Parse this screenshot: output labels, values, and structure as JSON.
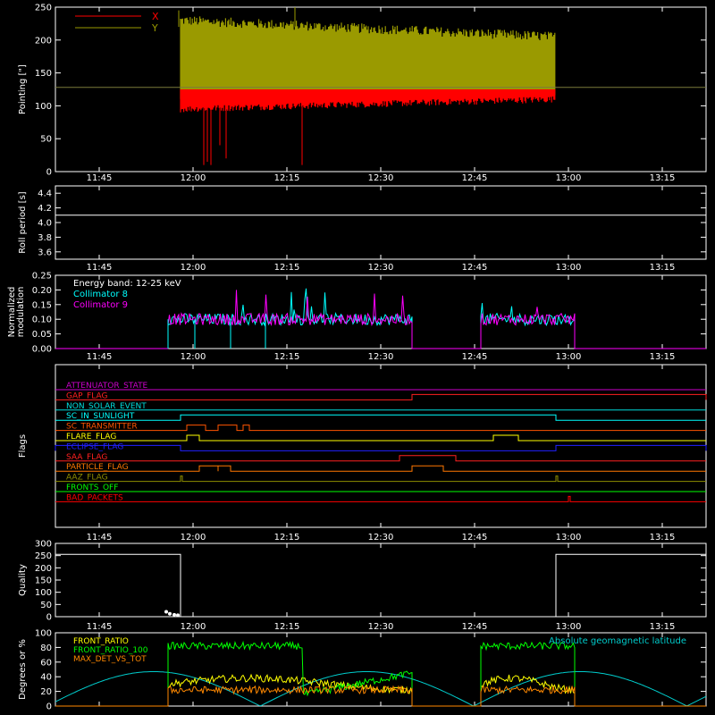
{
  "time_ticks": [
    "11:45",
    "12:00",
    "12:15",
    "12:30",
    "12:45",
    "13:00",
    "13:15"
  ],
  "chart_data": [
    {
      "type": "line",
      "ylabel": "Pointing [\"]",
      "ylim": [
        0,
        250
      ],
      "yticks": [
        "0",
        "50",
        "100",
        "150",
        "200",
        "250"
      ],
      "legend": [
        {
          "name": "X",
          "color": "#ff0000"
        },
        {
          "name": "Y",
          "color": "#9a9a00"
        }
      ],
      "x_range": [
        "11:38",
        "13:22"
      ],
      "series": [
        {
          "name": "X",
          "color": "#ff0000",
          "start": "11:58",
          "end": "12:58",
          "band_low": [
            95,
            112
          ],
          "band_high": [
            200,
            215
          ],
          "dips_to": [
            10,
            15,
            10,
            20,
            50
          ]
        },
        {
          "name": "Y",
          "color": "#9a9a00",
          "start": "11:58",
          "end": "12:58",
          "band_low": [
            100,
            115
          ],
          "band_high": [
            235,
            210
          ],
          "spikes_to": [
            245,
            250
          ]
        }
      ],
      "reference_line": 128
    },
    {
      "type": "line",
      "ylabel": "Roll period [s]",
      "ylim": [
        3.5,
        4.5
      ],
      "yticks": [
        "3.6",
        "3.8",
        "4.0",
        "4.2",
        "4.4"
      ],
      "series": [
        {
          "name": "",
          "color": "#ffffff",
          "value": 4.1
        }
      ]
    },
    {
      "type": "line",
      "ylabel": "Normalized modulation",
      "ylim": [
        0,
        0.25
      ],
      "yticks": [
        "0.00",
        "0.05",
        "0.10",
        "0.15",
        "0.20",
        "0.25"
      ],
      "annotation": "Energy band: 12-25 keV",
      "series": [
        {
          "name": "Collimator 8",
          "color": "#00ffff",
          "segments": [
            [
              "11:56",
              "12:35"
            ],
            [
              "12:46",
              "13:01"
            ]
          ],
          "level": 0.1
        },
        {
          "name": "Collimator 9",
          "color": "#ff00ff",
          "segments": [
            [
              "11:56",
              "12:35"
            ],
            [
              "12:46",
              "13:01"
            ]
          ],
          "level": 0.1
        }
      ]
    },
    {
      "type": "line",
      "ylabel": "Flags",
      "flags": [
        {
          "name": "ATTENUATOR_STATE",
          "color": "#cc00cc",
          "high": []
        },
        {
          "name": "GAP_FLAG",
          "color": "#ff2020",
          "high": [
            [
              "12:35",
              "13:22"
            ]
          ]
        },
        {
          "name": "NON_SOLAR_EVENT",
          "color": "#00dddd",
          "high": []
        },
        {
          "name": "SC_IN_SUNLIGHT",
          "color": "#00ffff",
          "high": [
            [
              "11:58",
              "12:58"
            ]
          ]
        },
        {
          "name": "SC_TRANSMITTER",
          "color": "#ff5500",
          "high": [
            [
              "11:59",
              "12:02"
            ],
            [
              "12:04",
              "12:07"
            ],
            [
              "12:08",
              "12:09"
            ]
          ]
        },
        {
          "name": "FLARE_FLAG",
          "color": "#ffff00",
          "high": [
            [
              "11:59",
              "12:01"
            ],
            [
              "12:48",
              "12:52"
            ]
          ]
        },
        {
          "name": "ECLIPSE_FLAG",
          "color": "#2020ff",
          "high": [
            [
              "11:38",
              "11:58"
            ],
            [
              "12:58",
              "13:22"
            ]
          ]
        },
        {
          "name": "SAA_FLAG",
          "color": "#ff2020",
          "high": [
            [
              "12:33",
              "12:42"
            ]
          ]
        },
        {
          "name": "PARTICLE_FLAG",
          "color": "#ff7700",
          "high": [
            [
              "12:01",
              "12:04"
            ],
            [
              "12:04",
              "12:06"
            ],
            [
              "12:35",
              "12:40"
            ]
          ]
        },
        {
          "name": "AAZ_FLAG",
          "color": "#8f8f00",
          "high": [
            [
              "11:58",
              "11:58"
            ],
            [
              "12:58",
              "12:58"
            ]
          ]
        },
        {
          "name": "FRONTS_OFF",
          "color": "#00ff00",
          "high": []
        },
        {
          "name": "BAD_PACKETS",
          "color": "#ff0000",
          "high": [
            [
              "13:00",
              "13:00"
            ]
          ]
        }
      ]
    },
    {
      "type": "line",
      "ylabel": "Quality",
      "ylim": [
        0,
        300
      ],
      "yticks": [
        "0",
        "50",
        "100",
        "150",
        "200",
        "250",
        "300"
      ],
      "series": [
        {
          "name": "",
          "color": "#ffffff",
          "high_value": 255,
          "high_segments": [
            [
              "11:38",
              "11:58"
            ],
            [
              "12:58",
              "13:22"
            ]
          ]
        }
      ]
    },
    {
      "type": "line",
      "ylabel": "Degrees or %",
      "ylim": [
        0,
        100
      ],
      "yticks": [
        "0",
        "20",
        "40",
        "60",
        "80",
        "100"
      ],
      "annotation": "Absolute geomagnetic latitude",
      "series": [
        {
          "name": "FRONT_RATIO",
          "color": "#ffff00",
          "level": 30
        },
        {
          "name": "FRONT_RATIO_100",
          "color": "#00ff00",
          "level": 82
        },
        {
          "name": "MAX_DET_VS_TOT",
          "color": "#ff8800",
          "level": 22
        },
        {
          "name": "Absolute geomagnetic latitude",
          "color": "#00cccc",
          "peak": 47
        }
      ],
      "segments": [
        [
          "11:56",
          "12:35"
        ],
        [
          "12:46",
          "13:01"
        ]
      ]
    }
  ]
}
